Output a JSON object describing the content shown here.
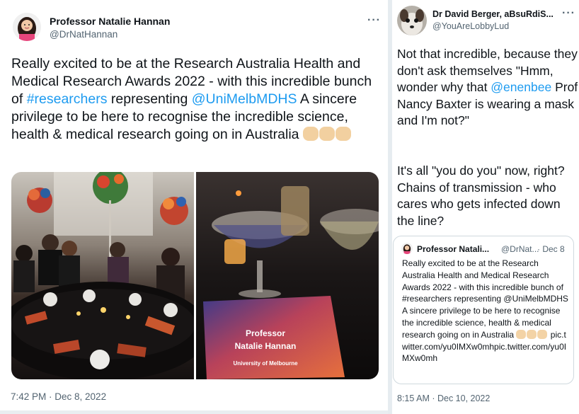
{
  "left_tweet": {
    "author_name": "Professor Natalie Hannan",
    "author_handle": "@DrNatHannan",
    "more_label": "···",
    "text_parts": {
      "p1": "Really excited to be at the Research Australia Health and Medical Research Awards 2022 - with this incredible bunch of ",
      "hashtag": "#researchers",
      "p2": " representing ",
      "mention": "@UniMelbMDHS",
      "p3": " A sincere privilege to be here to recognise the incredible science, health & medical research going on in Australia "
    },
    "photo_card_text": {
      "line1": "Professor",
      "line2": "Natalie Hannan",
      "line3": "University of Melbourne"
    },
    "timestamp": "7:42 PM · Dec 8, 2022"
  },
  "right_tweet": {
    "author_name": "Dr David Berger, aBsuRdiS...",
    "author_handle": "@YouAreLobbyLud",
    "more_label": "···",
    "text_parts": {
      "p1": "Not that incredible, because they don't ask themselves \"Hmm, wonder why that ",
      "mention": "@enenbee",
      "p2": " Prof Nancy Baxter is wearing a mask and I'm not?\"",
      "p3": "It's all \"you do you\" now, right? Chains of transmission - who cares who gets infected down the line?"
    },
    "timestamp": "8:15 AM · Dec 10, 2022"
  },
  "quote_tweet": {
    "author_name": "Professor Natali...",
    "author_handle": "@DrNat...",
    "date": "· Dec 8",
    "text_main": "Really excited to be at the Research Australia Health and Medical Research Awards 2022 - with this incredible bunch of #researchers representing @UniMelbMDHS A sincere privilege to be here to recognise the incredible science, health & medical research going on in Australia ",
    "text_link": " pic.twitter.com/yu0IMXw0mhpic.twitter.com/yu0IMXw0mh"
  },
  "icons": [
    "avatar-woman-icon",
    "avatar-dog-icon",
    "more-icon",
    "clapping-hands-icon"
  ],
  "colors": {
    "link": "#1d9bf0",
    "text": "#0f1419",
    "secondary": "#536471",
    "border": "#cfd9de"
  }
}
